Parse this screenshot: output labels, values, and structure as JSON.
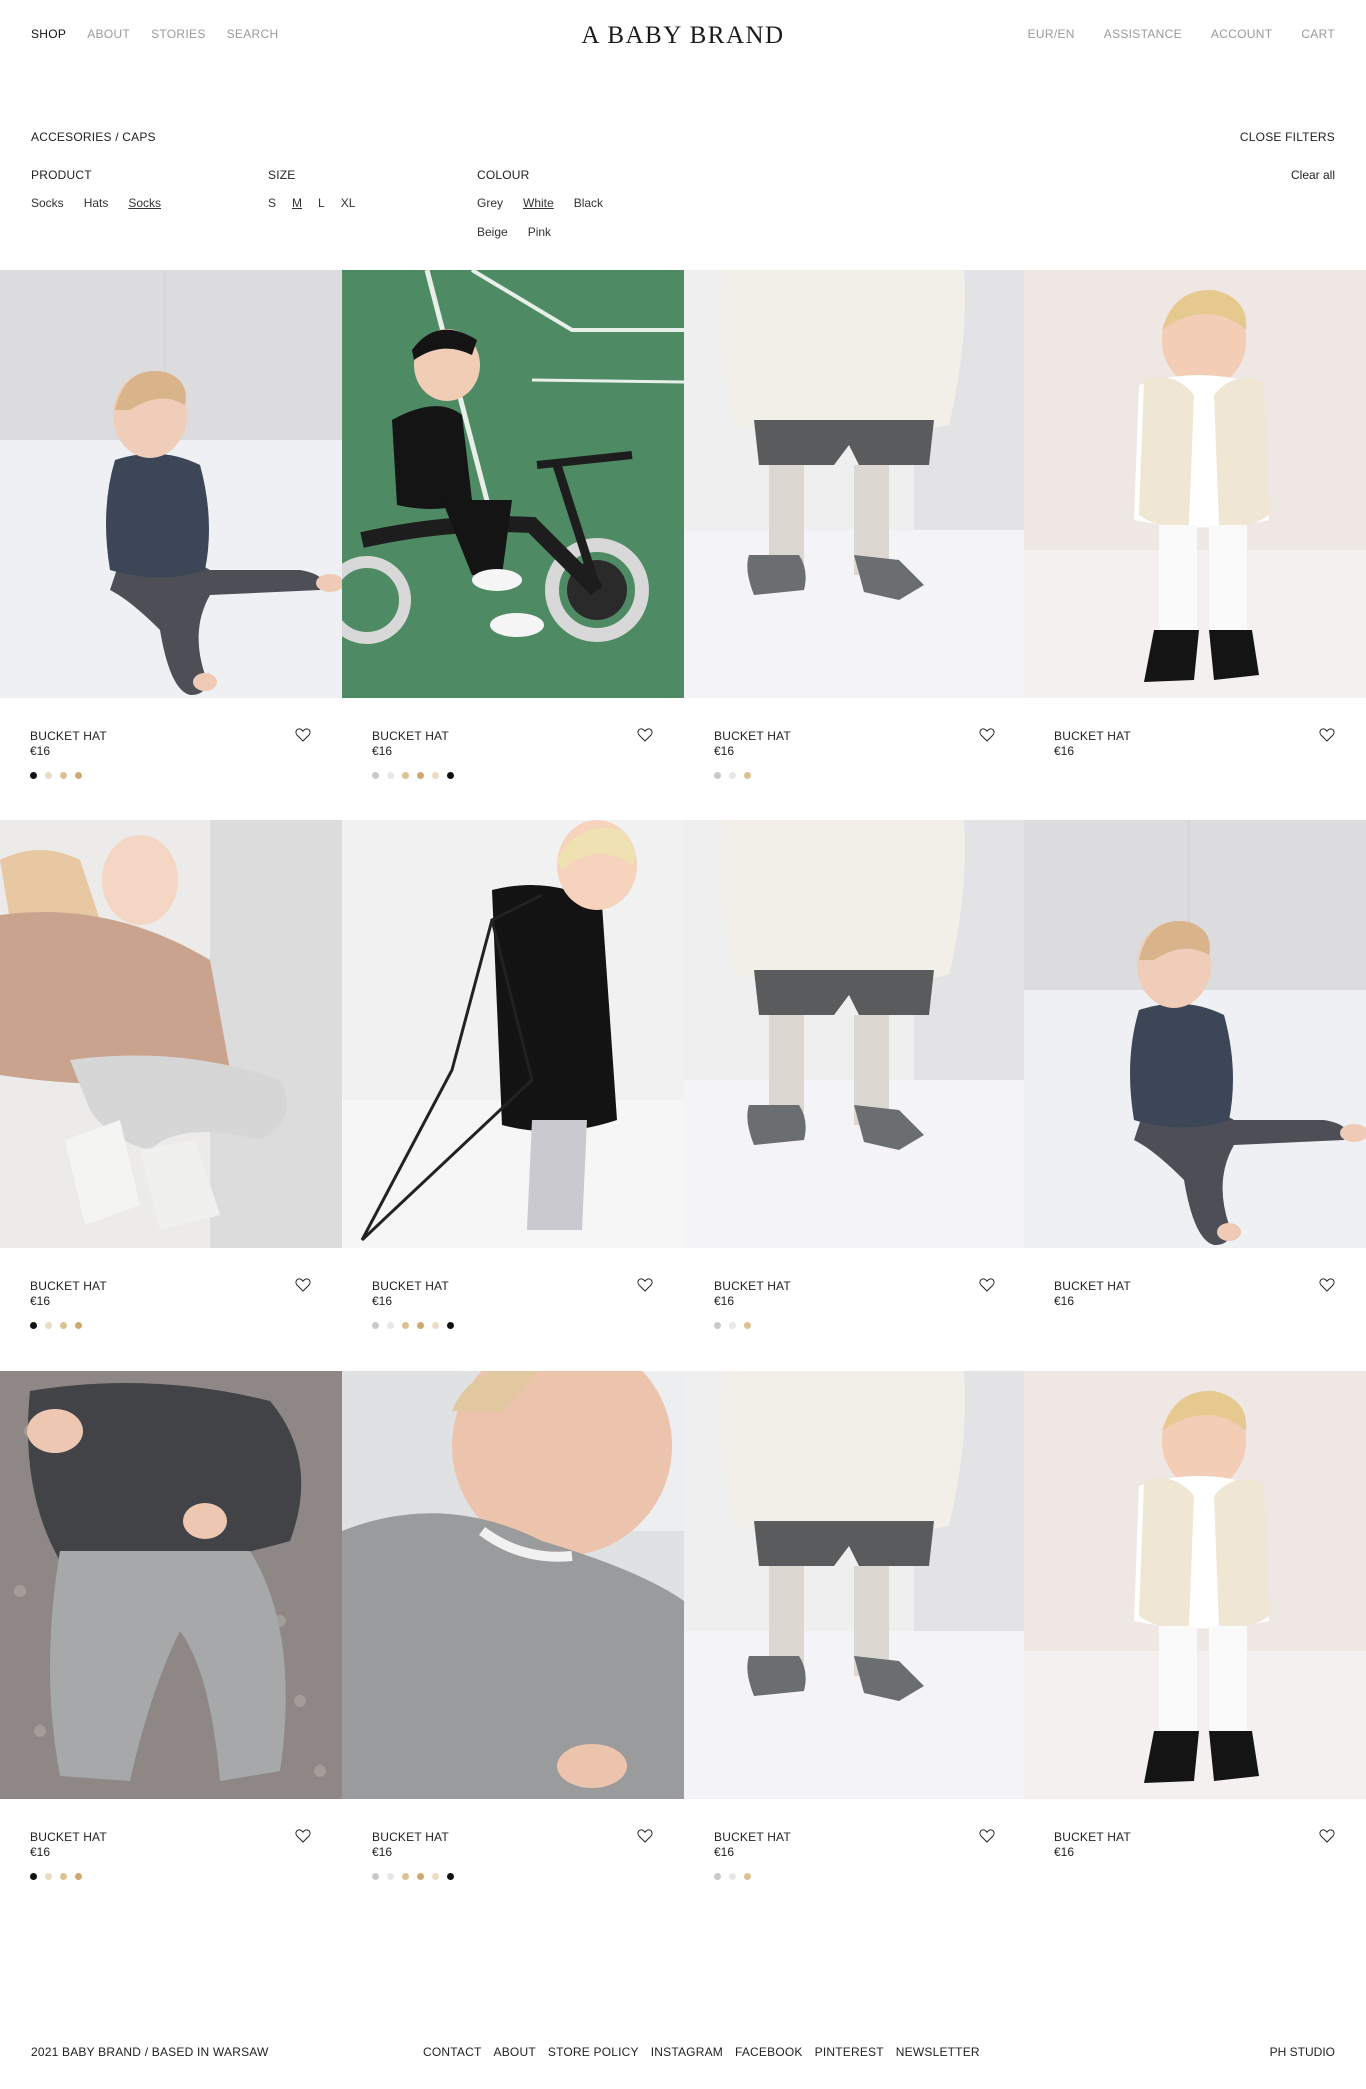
{
  "header": {
    "nav_left": [
      "SHOP",
      "ABOUT",
      "STORIES",
      "SEARCH"
    ],
    "logo": "A BABY BRAND",
    "nav_right": [
      "EUR/EN",
      "ASSISTANCE",
      "ACCOUNT",
      "CART"
    ]
  },
  "filters": {
    "breadcrumb": "ACCESORIES  / CAPS",
    "close_label": "CLOSE FILTERS",
    "clear_label": "Clear all",
    "product": {
      "title": "PRODUCT",
      "options": [
        "Socks",
        "Hats",
        "Socks"
      ],
      "selected": "Socks (3rd option)"
    },
    "size": {
      "title": "SIZE",
      "options": [
        "S",
        "M",
        "L",
        "XL"
      ],
      "selected": "M"
    },
    "colour": {
      "title": "COLOUR",
      "options": [
        "Grey",
        "White",
        "Black",
        "Beige",
        "Pink"
      ],
      "selected": "White"
    }
  },
  "products": [
    {
      "name": "BUCKET HAT",
      "price": "€16",
      "scene": "toddler-navy-seated",
      "swatches": [
        "#111111",
        "#e9dcc5",
        "#dcc293",
        "#cfa86e"
      ]
    },
    {
      "name": "BUCKET HAT",
      "price": "€16",
      "scene": "toddler-balance-bike",
      "swatches": [
        "#c9c9c9",
        "#e7e7e7",
        "#dcc293",
        "#cfa86e",
        "#e9dcc5",
        "#111111"
      ]
    },
    {
      "name": "BUCKET HAT",
      "price": "€16",
      "scene": "toddler-cream-shorts",
      "swatches": [
        "#c9c9c9",
        "#e7e7e7",
        "#dcc293"
      ]
    },
    {
      "name": "BUCKET HAT",
      "price": "€16",
      "scene": "toddler-sherpa-vest",
      "swatches": []
    },
    {
      "name": "BUCKET HAT",
      "price": "€16",
      "scene": "toddler-beige-sweater",
      "swatches": [
        "#111111",
        "#e9dcc5",
        "#dcc293",
        "#cfa86e"
      ]
    },
    {
      "name": "BUCKET HAT",
      "price": "€16",
      "scene": "toddler-black-hanger",
      "swatches": [
        "#c9c9c9",
        "#e7e7e7",
        "#dcc293",
        "#cfa86e",
        "#e9dcc5",
        "#111111"
      ]
    },
    {
      "name": "BUCKET HAT",
      "price": "€16",
      "scene": "toddler-cream-shorts",
      "swatches": [
        "#c9c9c9",
        "#e7e7e7",
        "#dcc293"
      ]
    },
    {
      "name": "BUCKET HAT",
      "price": "€16",
      "scene": "toddler-navy-seated",
      "swatches": []
    },
    {
      "name": "BUCKET HAT",
      "price": "€16",
      "scene": "toddler-grey-rug",
      "swatches": [
        "#111111",
        "#e9dcc5",
        "#dcc293",
        "#cfa86e"
      ]
    },
    {
      "name": "BUCKET HAT",
      "price": "€16",
      "scene": "toddler-grey-closeup",
      "swatches": [
        "#c9c9c9",
        "#e7e7e7",
        "#dcc293",
        "#cfa86e",
        "#e9dcc5",
        "#111111"
      ]
    },
    {
      "name": "BUCKET HAT",
      "price": "€16",
      "scene": "toddler-cream-shorts",
      "swatches": [
        "#c9c9c9",
        "#e7e7e7",
        "#dcc293"
      ]
    },
    {
      "name": "BUCKET HAT",
      "price": "€16",
      "scene": "toddler-sherpa-vest",
      "swatches": []
    }
  ],
  "footer": {
    "left": "2021 BABY BRAND / BASED IN WARSAW",
    "links": [
      "CONTACT",
      "ABOUT",
      "STORE POLICY",
      "INSTAGRAM",
      "FACEBOOK",
      "PINTEREST",
      "NEWSLETTER"
    ],
    "right": "PH STUDIO"
  }
}
